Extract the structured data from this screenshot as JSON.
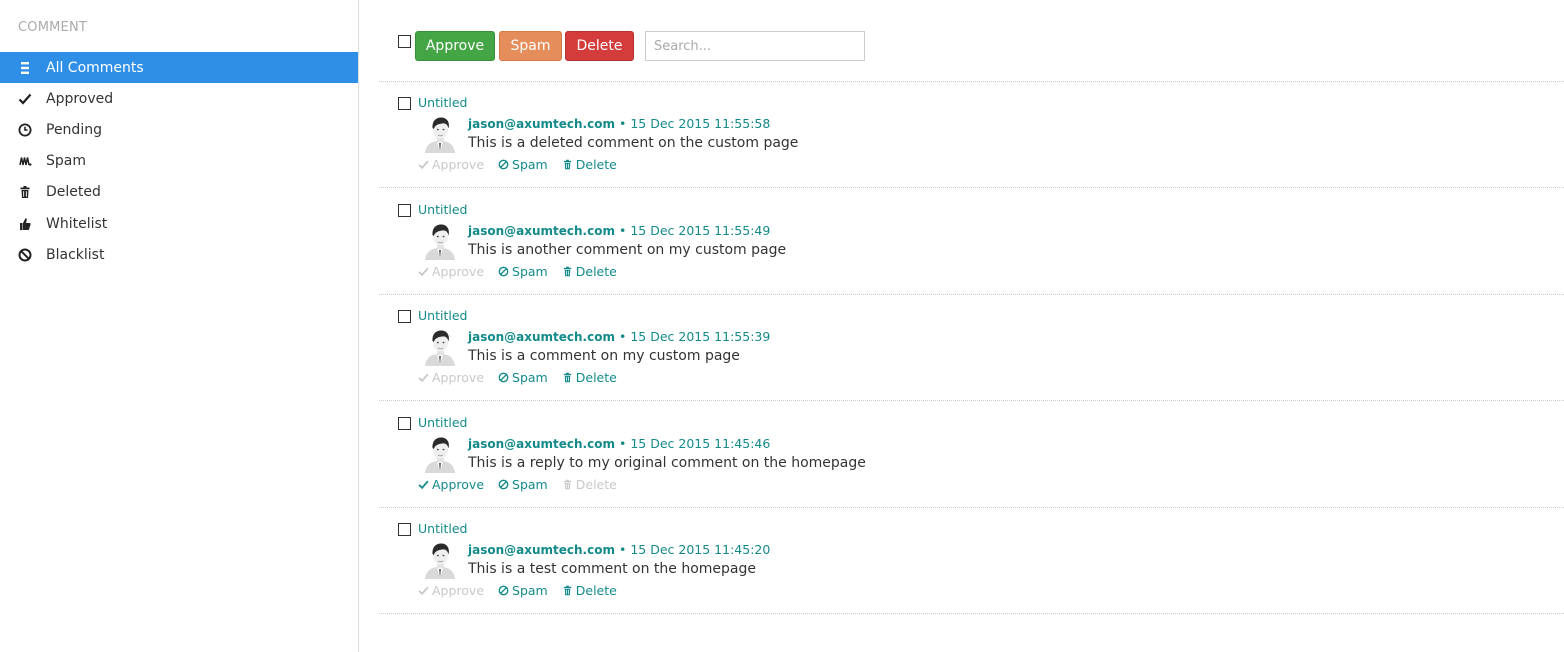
{
  "sidebar": {
    "heading": "COMMENT",
    "items": [
      {
        "label": "All Comments",
        "icon": "list-icon",
        "active": true
      },
      {
        "label": "Approved",
        "icon": "checkmark-icon"
      },
      {
        "label": "Pending",
        "icon": "clock-icon"
      },
      {
        "label": "Spam",
        "icon": "spam-icon"
      },
      {
        "label": "Deleted",
        "icon": "trash-icon"
      },
      {
        "label": "Whitelist",
        "icon": "thumbs-up-icon"
      },
      {
        "label": "Blacklist",
        "icon": "ban-icon"
      }
    ]
  },
  "toolbar": {
    "approve_label": "Approve",
    "spam_label": "Spam",
    "delete_label": "Delete",
    "search_placeholder": "Search..."
  },
  "actions": {
    "approve": "Approve",
    "spam": "Spam",
    "delete": "Delete",
    "separator": "•"
  },
  "colors": {
    "accent": "#2f8fe6",
    "link": "#138a8a",
    "approve": "#43a543",
    "spam": "#e58e5c",
    "delete": "#d43c3c"
  },
  "comments": [
    {
      "title": "Untitled",
      "author": "jason@axumtech.com",
      "date": "15 Dec 2015 11:55:58",
      "text": "This is a deleted comment on the custom page",
      "approve_enabled": false,
      "spam_enabled": true,
      "delete_enabled": true
    },
    {
      "title": "Untitled",
      "author": "jason@axumtech.com",
      "date": "15 Dec 2015 11:55:49",
      "text": "This is another comment on my custom page",
      "approve_enabled": false,
      "spam_enabled": true,
      "delete_enabled": true
    },
    {
      "title": "Untitled",
      "author": "jason@axumtech.com",
      "date": "15 Dec 2015 11:55:39",
      "text": "This is a comment on my custom page",
      "approve_enabled": false,
      "spam_enabled": true,
      "delete_enabled": true
    },
    {
      "title": "Untitled",
      "author": "jason@axumtech.com",
      "date": "15 Dec 2015 11:45:46",
      "text": "This is a reply to my original comment on the homepage",
      "approve_enabled": true,
      "spam_enabled": true,
      "delete_enabled": false
    },
    {
      "title": "Untitled",
      "author": "jason@axumtech.com",
      "date": "15 Dec 2015 11:45:20",
      "text": "This is a test comment on the homepage",
      "approve_enabled": false,
      "spam_enabled": true,
      "delete_enabled": true
    }
  ]
}
